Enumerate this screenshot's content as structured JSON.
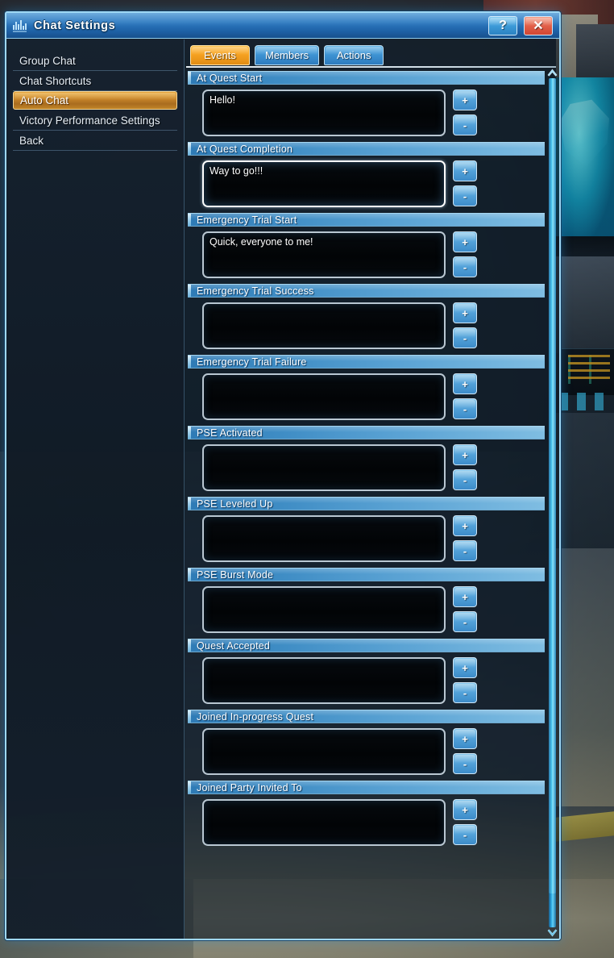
{
  "window": {
    "title": "Chat Settings",
    "icon": "equalizer-icon",
    "help_label": "?",
    "close_label": "✕"
  },
  "sidebar": {
    "items": [
      {
        "label": "Group Chat",
        "active": false
      },
      {
        "label": "Chat Shortcuts",
        "active": false
      },
      {
        "label": "Auto Chat",
        "active": true
      },
      {
        "label": "Victory Performance Settings",
        "active": false
      },
      {
        "label": "Back",
        "active": false
      }
    ]
  },
  "tabs": [
    {
      "label": "Events",
      "active": true
    },
    {
      "label": "Members",
      "active": false
    },
    {
      "label": "Actions",
      "active": false
    }
  ],
  "buttons": {
    "add_label": "+",
    "remove_label": "-"
  },
  "sections": [
    {
      "title": "At Quest Start",
      "value": "Hello!",
      "selected": false
    },
    {
      "title": "At Quest Completion",
      "value": "Way to go!!!",
      "selected": true
    },
    {
      "title": "Emergency Trial Start",
      "value": "Quick, everyone to me!",
      "selected": false
    },
    {
      "title": "Emergency Trial Success",
      "value": "",
      "selected": false
    },
    {
      "title": "Emergency Trial Failure",
      "value": "",
      "selected": false
    },
    {
      "title": "PSE Activated",
      "value": "",
      "selected": false
    },
    {
      "title": "PSE Leveled Up",
      "value": "",
      "selected": false
    },
    {
      "title": "PSE Burst Mode",
      "value": "",
      "selected": false
    },
    {
      "title": "Quest Accepted",
      "value": "",
      "selected": false
    },
    {
      "title": "Joined In-progress Quest",
      "value": "",
      "selected": false
    },
    {
      "title": "Joined Party Invited To",
      "value": "",
      "selected": false
    }
  ],
  "scrollbar": {
    "up_icon": "chevron-up-icon",
    "down_icon": "chevron-down-icon"
  },
  "colors": {
    "accent_blue": "#3f94d4",
    "active_tab_orange": "#f6a221",
    "selected_item_gold": "#c9862a",
    "frame_border": "#9fd8f5",
    "close_red": "#e2604a"
  }
}
